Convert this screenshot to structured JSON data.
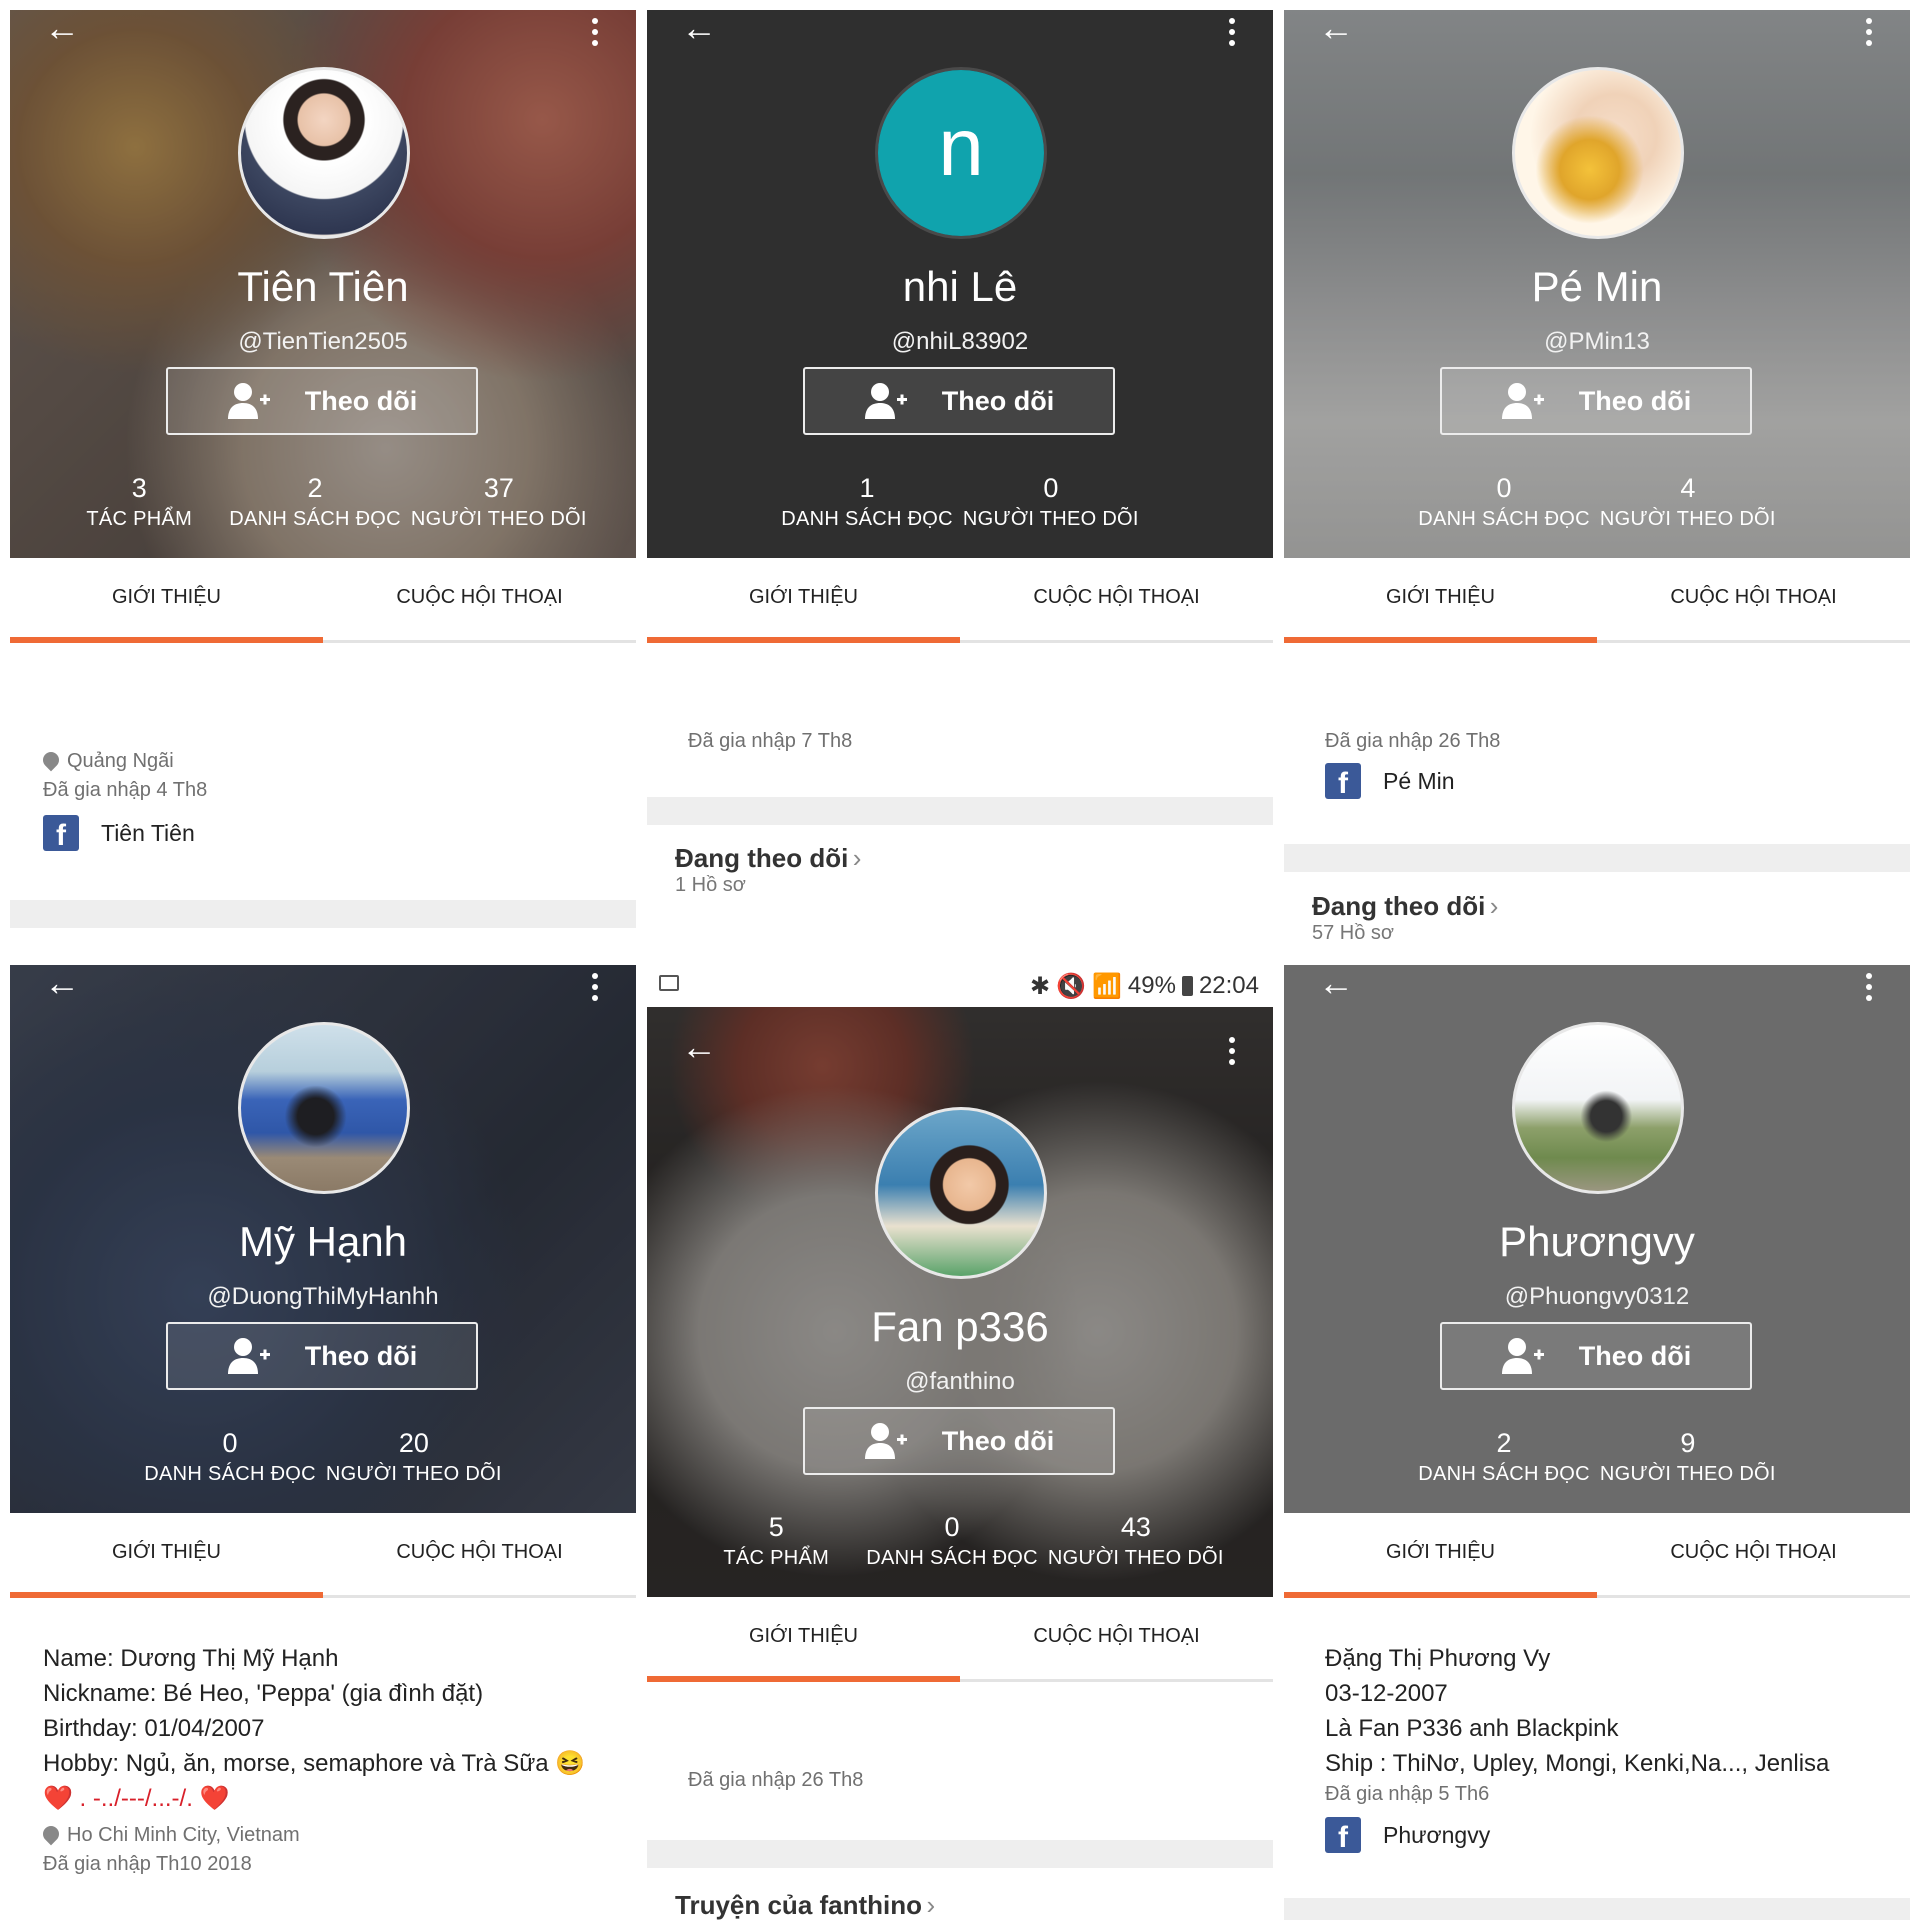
{
  "panels": [
    {
      "name": "Tiên Tiên",
      "handle": "@TienTien2505",
      "follow_label": "Theo dõi",
      "stats": [
        {
          "num": "3",
          "label": "TÁC PHẨM"
        },
        {
          "num": "2",
          "label": "DANH SÁCH ĐỌC"
        },
        {
          "num": "37",
          "label": "NGƯỜI THEO DÕI"
        }
      ],
      "tabs": [
        "GIỚI THIỆU",
        "CUỘC HỘI THOẠI"
      ],
      "location": "Quảng Ngãi",
      "joined": "Đã gia nhập 4 Th8",
      "facebook": "Tiên Tiên"
    },
    {
      "avatar_letter": "n",
      "name": "nhi Lê",
      "handle": "@nhiL83902",
      "follow_label": "Theo dõi",
      "stats": [
        {
          "num": "1",
          "label": "DANH SÁCH ĐỌC"
        },
        {
          "num": "0",
          "label": "NGƯỜI THEO DÕI"
        }
      ],
      "tabs": [
        "GIỚI THIỆU",
        "CUỘC HỘI THOẠI"
      ],
      "joined": "Đã gia nhập 7 Th8",
      "following_title": "Đang theo dõi",
      "following_sub": "1 Hồ sơ"
    },
    {
      "name": "Pé Min",
      "handle": "@PMin13",
      "follow_label": "Theo dõi",
      "stats": [
        {
          "num": "0",
          "label": "DANH SÁCH ĐỌC"
        },
        {
          "num": "4",
          "label": "NGƯỜI THEO DÕI"
        }
      ],
      "tabs": [
        "GIỚI THIỆU",
        "CUỘC HỘI THOẠI"
      ],
      "joined": "Đã gia nhập 26 Th8",
      "facebook": "Pé Min",
      "following_title": "Đang theo dõi",
      "following_sub": "57 Hồ sơ"
    },
    {
      "name": "Mỹ Hạnh",
      "handle": "@DuongThiMyHanhh",
      "follow_label": "Theo dõi",
      "stats": [
        {
          "num": "0",
          "label": "DANH SÁCH ĐỌC"
        },
        {
          "num": "20",
          "label": "NGƯỜI THEO DÕI"
        }
      ],
      "tabs": [
        "GIỚI THIỆU",
        "CUỘC HỘI THOẠI"
      ],
      "bio": [
        "Name: Dương Thị Mỹ Hạnh",
        "Nickname: Bé Heo, 'Peppa' (gia đình đặt)",
        "Birthday: 01/04/2007",
        "Hobby: Ngủ, ăn, morse, semaphore và Trà Sữa 😆",
        "❤️ . -../---/...-/. ❤️"
      ],
      "location": "Ho Chi Minh City, Vietnam",
      "joined": "Đã gia nhập Th10 2018"
    },
    {
      "status": {
        "battery": "49%",
        "time": "22:04"
      },
      "name": "Fan p336",
      "handle": "@fanthino",
      "follow_label": "Theo dõi",
      "stats": [
        {
          "num": "5",
          "label": "TÁC PHẨM"
        },
        {
          "num": "0",
          "label": "DANH SÁCH ĐỌC"
        },
        {
          "num": "43",
          "label": "NGƯỜI THEO DÕI"
        }
      ],
      "tabs": [
        "GIỚI THIỆU",
        "CUỘC HỘI THOẠI"
      ],
      "joined": "Đã gia nhập 26 Th8",
      "stories_title": "Truyện của fanthino"
    },
    {
      "name": "Phươngvy",
      "handle": "@Phuongvy0312",
      "follow_label": "Theo dõi",
      "stats": [
        {
          "num": "2",
          "label": "DANH SÁCH ĐỌC"
        },
        {
          "num": "9",
          "label": "NGƯỜI THEO DÕI"
        }
      ],
      "tabs": [
        "GIỚI THIỆU",
        "CUỘC HỘI THOẠI"
      ],
      "bio": [
        "Đặng Thị Phương Vy",
        "03-12-2007",
        "Là Fan P336 anh Blackpink",
        "Ship : ThiNơ, Upley, Mongi, Kenki,Na..., Jenlisa"
      ],
      "joined": "Đã gia nhập 5 Th6",
      "facebook": "Phươngvy"
    }
  ],
  "colors": {
    "accent": "#ef6a35",
    "facebook": "#3b5998",
    "avatar_teal": "#10a3ad"
  },
  "icons": [
    "back-arrow-icon",
    "more-vert-icon",
    "add-user-icon",
    "location-pin-icon",
    "facebook-icon",
    "chevron-right-icon"
  ]
}
